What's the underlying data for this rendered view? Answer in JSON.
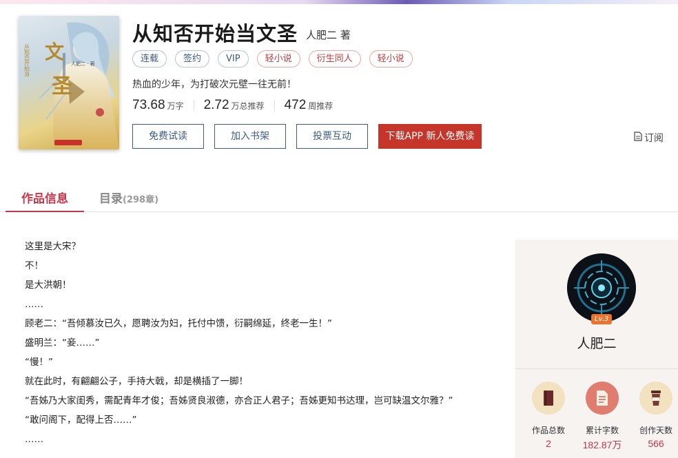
{
  "book": {
    "title": "从知否开始当文圣",
    "author": "人肥二 著",
    "tags": [
      {
        "label": "连载",
        "style": "blue"
      },
      {
        "label": "签约",
        "style": "blue"
      },
      {
        "label": "VIP",
        "style": "blue"
      },
      {
        "label": "轻小说",
        "style": "red"
      },
      {
        "label": "衍生同人",
        "style": "red"
      },
      {
        "label": "轻小说",
        "style": "red"
      }
    ],
    "intro": "热血的少年，为打破次元壁一往无前！",
    "stats": [
      {
        "number": "73.68",
        "unit": "万字"
      },
      {
        "number": "2.72",
        "unit": "万总推荐"
      },
      {
        "number": "472",
        "unit": "周推荐"
      }
    ],
    "cover": {
      "big_char_1": "文",
      "big_char_2": "圣",
      "side_text": "从知否开始当",
      "cover_author": "人肥二 · 著"
    }
  },
  "actions": {
    "free_read": "免费试读",
    "add_shelf": "加入书架",
    "vote": "投票互动",
    "download_app": "下载APP 新人免费读",
    "subscribe": "订阅"
  },
  "tabs": {
    "info": "作品信息",
    "toc": "目录",
    "toc_count": "(298章)"
  },
  "description": [
    "这里是大宋？",
    "不！",
    "是大洪朝！",
    "……",
    "顾老二：“吾倾慕汝已久，愿聘汝为妇，托付中馈，衍嗣绵延，终老一生！”",
    "盛明兰：“妾……”",
    "“慢！”",
    "就在此时，有翩翩公子，手持大戟，却是横插了一脚！",
    "“吾姊乃大家闺秀，需配青年才俊；吾姊贤良淑德，亦合正人君子；吾姊更知书达理，岂可缺温文尔雅？”",
    "“敢问阁下，配得上否……”",
    "……"
  ],
  "author_panel": {
    "level": "Lv.3",
    "name": "人肥二",
    "metrics": [
      {
        "label": "作品总数",
        "value": "2",
        "icon": "book-icon",
        "color": "#f3e2bf"
      },
      {
        "label": "累计字数",
        "value": "182.87万",
        "icon": "document-icon",
        "color": "#e07d6f"
      },
      {
        "label": "创作天数",
        "value": "566",
        "icon": "coffee-cup-icon",
        "color": "#f3e2bf"
      }
    ]
  },
  "colors": {
    "accent": "#c8364b",
    "app_button": "#c5352a",
    "button_border": "#3d5d80"
  }
}
